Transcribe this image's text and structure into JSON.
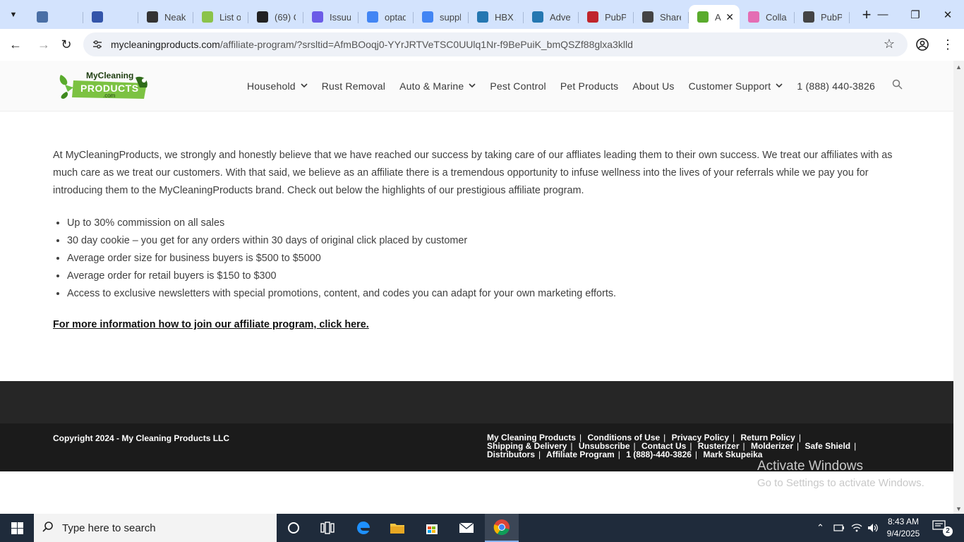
{
  "browser": {
    "tabs": [
      {
        "title": "",
        "icon": "graduation-cap-icon",
        "color": "#4a6fa5"
      },
      {
        "title": "",
        "icon": "exchange-icon",
        "color": "#3355aa"
      },
      {
        "title": "Neaka",
        "icon": "globe-icon",
        "color": "#333333"
      },
      {
        "title": "List of",
        "icon": "w-icon",
        "color": "#8bc34a"
      },
      {
        "title": "(69) C",
        "icon": "b-icon",
        "color": "#222222"
      },
      {
        "title": "Issuu",
        "icon": "issuu-icon",
        "color": "#6b5ce7"
      },
      {
        "title": "optad",
        "icon": "google-icon",
        "color": "#4285f4"
      },
      {
        "title": "suppl",
        "icon": "google-icon",
        "color": "#4285f4"
      },
      {
        "title": "HBX A",
        "icon": "xf-icon",
        "color": "#2577b1"
      },
      {
        "title": "Advet",
        "icon": "xf-icon",
        "color": "#2577b1"
      },
      {
        "title": "PubPc",
        "icon": "pdf-icon",
        "color": "#c0242b"
      },
      {
        "title": "Share",
        "icon": "globe-icon",
        "color": "#444444"
      },
      {
        "title": "A",
        "icon": "leaf-icon",
        "color": "#5aab2d",
        "active": true
      },
      {
        "title": "Collab",
        "icon": "collab-icon",
        "color": "#e46db4"
      },
      {
        "title": "PubPc",
        "icon": "globe-icon",
        "color": "#444444"
      }
    ],
    "url_host": "mycleaningproducts.com",
    "url_rest": "/affiliate-program/?srsltid=AfmBOoqj0-YYrJRTVeTSC0UUlq1Nr-f9BePuiK_bmQSZf88glxa3klld"
  },
  "site": {
    "logo_text_top": "MyCleaning",
    "logo_text_main": "PRODUCTS",
    "logo_text_sub": ".com",
    "nav": [
      {
        "label": "Household",
        "dropdown": true
      },
      {
        "label": "Rust Removal",
        "dropdown": false
      },
      {
        "label": "Auto & Marine",
        "dropdown": true
      },
      {
        "label": "Pest Control",
        "dropdown": false
      },
      {
        "label": "Pet Products",
        "dropdown": false
      },
      {
        "label": "About Us",
        "dropdown": false
      },
      {
        "label": "Customer Support",
        "dropdown": true
      },
      {
        "label": "1 (888) 440-3826",
        "dropdown": false
      }
    ]
  },
  "content": {
    "intro": "At MyCleaningProducts, we strongly and honestly believe that we have reached our success by taking care of our affliates leading them to their own success. We treat our affiliates with as much care as we treat our customers. With that said, we believe as an affiliate there is a tremendous opportunity to infuse wellness into the lives of your referrals while we pay you for introducing them to the MyCleaningProducts brand. Check out below the highlights of our prestigious affiliate program.",
    "highlights": [
      "Up to 30% commission on all sales",
      "30 day cookie – you get for any orders within 30 days of original click placed by customer",
      "Average order size for business buyers is $500 to $5000",
      "Average order for retail buyers is $150 to $300",
      "Access to exclusive newsletters with special promotions, content, and codes you can adapt for your own marketing efforts."
    ],
    "cta": "For more information how to join our affiliate program, click here."
  },
  "footer": {
    "copyright": "Copyright 2024 - My Cleaning Products LLC",
    "links": [
      "My Cleaning Products",
      "Conditions of Use",
      "Privacy Policy",
      "Return Policy",
      "Shipping & Delivery",
      "Unsubscribe",
      "Contact Us",
      "Rusterizer",
      "Molderizer",
      "Safe Shield",
      "Distributors",
      "Affiliate Program",
      "1 (888)-440-3826",
      "Mark Skupeika"
    ]
  },
  "watermark": {
    "line1": "Activate Windows",
    "line2": "Go to Settings to activate Windows."
  },
  "taskbar": {
    "search_placeholder": "Type here to search",
    "time": "8:43 AM",
    "date": "9/4/2025",
    "notifications": "2"
  }
}
